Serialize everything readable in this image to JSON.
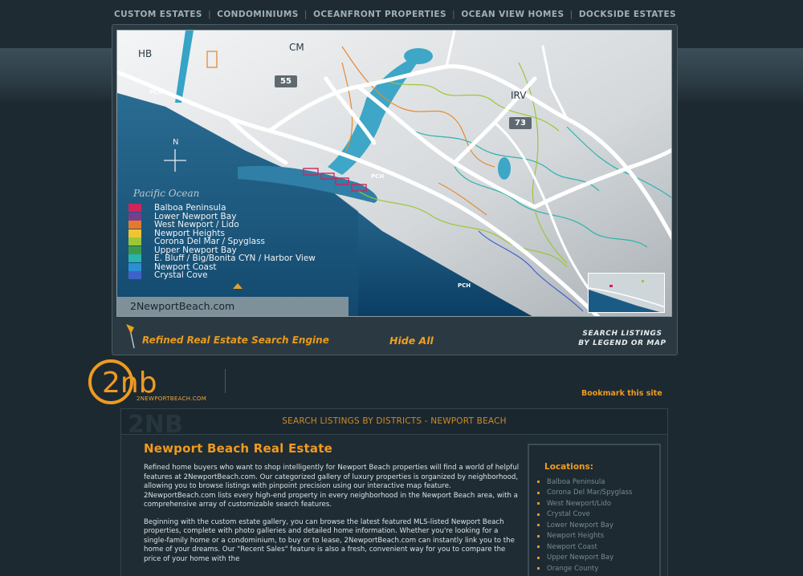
{
  "nav": {
    "items": [
      {
        "label": "CUSTOM ESTATES"
      },
      {
        "label": "CONDOMINIUMS"
      },
      {
        "label": "OCEANFRONT PROPERTIES"
      },
      {
        "label": "OCEAN VIEW HOMES"
      },
      {
        "label": "DOCKSIDE ESTATES"
      }
    ],
    "separator": "|"
  },
  "map": {
    "labels": {
      "hb": "HB",
      "cm": "CM",
      "irv": "IRV",
      "north": "N"
    },
    "shields": {
      "r55": "55",
      "r73": "73"
    },
    "pch": "PCH",
    "ocean_label": "Pacific Ocean",
    "brand": "2NewportBeach.com",
    "legend": [
      {
        "label": "Balboa Peninsula",
        "color": "#d0245c"
      },
      {
        "label": "Lower Newport Bay",
        "color": "#7a3d8e"
      },
      {
        "label": "West Newport / Lido",
        "color": "#e77a2a"
      },
      {
        "label": "Newport Heights",
        "color": "#f2c530"
      },
      {
        "label": "Corona Del Mar / Spyglass",
        "color": "#9cc63a"
      },
      {
        "label": "Upper Newport Bay",
        "color": "#3b9b4b"
      },
      {
        "label": "E. Bluff / Big/Bonita CYN / Harbor View",
        "color": "#2bb3ad"
      },
      {
        "label": "Newport Coast",
        "color": "#2c8fd6"
      },
      {
        "label": "Crystal Cove",
        "color": "#3f62c8"
      }
    ]
  },
  "map_bar": {
    "tagline": "Refined Real Estate Search Engine",
    "hide_all": "Hide All",
    "search_line1": "Search Listings",
    "search_line2": "by Legend or Map"
  },
  "logo": {
    "text": "2nb",
    "url": "2NEWPORTBEACH.COM"
  },
  "bookmark": "Bookmark this site",
  "section": {
    "watermark": "2NB",
    "title": "SEARCH LISTINGS BY DISTRICTS - NEWPORT BEACH"
  },
  "article": {
    "heading": "Newport Beach Real Estate",
    "p1": "Refined home buyers who want to shop intelligently for Newport Beach properties will find a world of helpful features at 2NewportBeach.com. Our categorized gallery of luxury properties is organized by neighborhood, allowing you to browse listings with pinpoint precision using our interactive map feature. 2NewportBeach.com lists every high-end property in every neighborhood in the Newport Beach area, with a comprehensive array of customizable search features.",
    "p2": "Beginning with the custom estate gallery, you can browse the latest featured MLS-listed Newport Beach properties, complete with photo galleries and detailed home information. Whether you're looking for a single-family home or a condominium, to buy or to lease, 2NewportBeach.com can instantly link you to the home of your dreams. Our \"Recent Sales\" feature is also a fresh, convenient way for you to compare the price of your home with the"
  },
  "locations": {
    "title": "Locations:",
    "items": [
      "Balboa Peninsula",
      "Corona Del Mar/Spyglass",
      "West Newport/Lido",
      "Crystal Cove",
      "Lower Newport Bay",
      "Newport Heights",
      "Newport Coast",
      "Upper Newport Bay",
      "Orange County"
    ]
  }
}
